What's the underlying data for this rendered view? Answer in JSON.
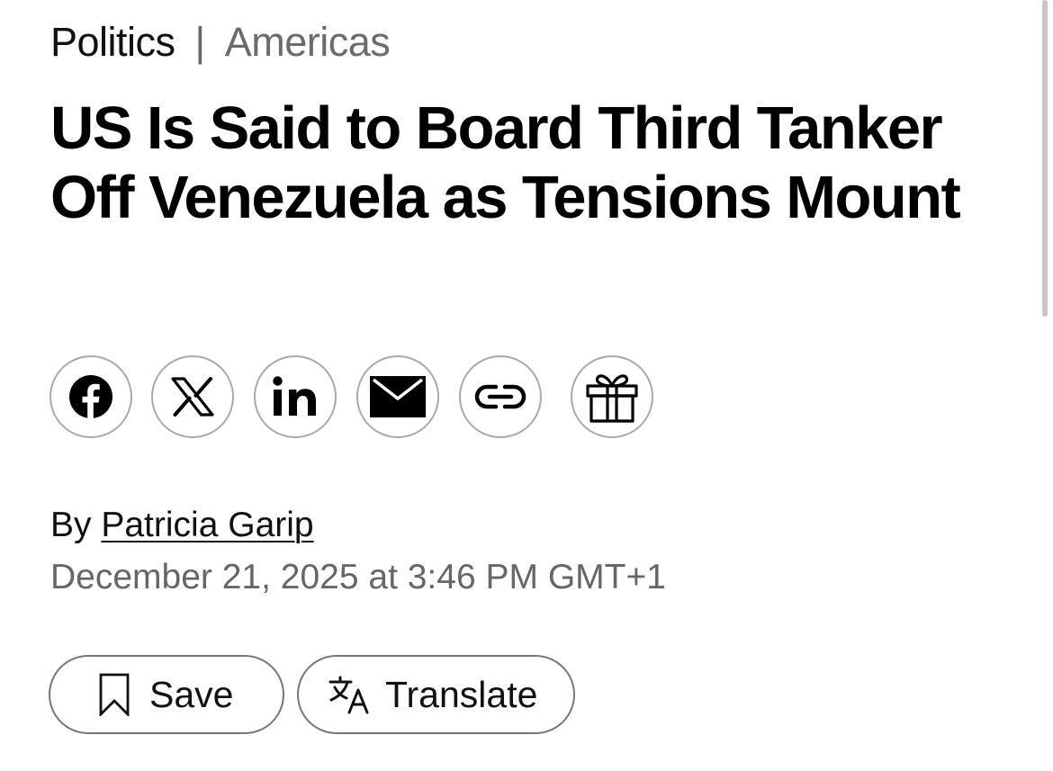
{
  "breadcrumb": {
    "section": "Politics",
    "separator": "|",
    "region": "Americas"
  },
  "headline": "US Is Said to Board Third Tanker Off Venezuela as Tensions Mount",
  "share": {
    "buttons": [
      {
        "icon": "facebook-icon"
      },
      {
        "icon": "x-icon"
      },
      {
        "icon": "linkedin-icon"
      },
      {
        "icon": "email-icon"
      },
      {
        "icon": "link-icon"
      },
      {
        "icon": "gift-icon"
      }
    ]
  },
  "byline": {
    "prefix": "By",
    "author": "Patricia Garip"
  },
  "published": "December 21, 2025 at 3:46 PM GMT+1",
  "actions": {
    "save_label": "Save",
    "translate_label": "Translate"
  },
  "colors": {
    "text": "#000000",
    "muted": "#666666",
    "button_border": "#6f7784",
    "share_border": "#a9a9a9"
  }
}
